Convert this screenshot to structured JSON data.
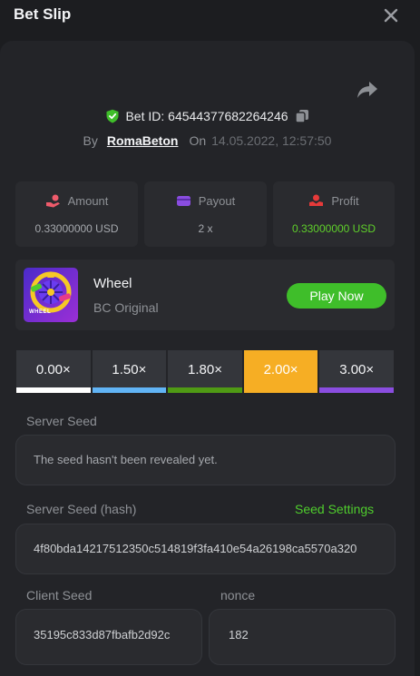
{
  "header": {
    "title": "Bet Slip",
    "close_icon": "close-icon"
  },
  "bet": {
    "bet_id": "Bet ID: 64544377682264246",
    "by_label": "By",
    "username": "RomaBeton",
    "on_label": "On",
    "date": "14.05.2022, 12:57:50"
  },
  "stats": {
    "amount_label": "Amount",
    "amount_value": "0.33000000 USD",
    "payout_label": "Payout",
    "payout_value": "2 x",
    "profit_label": "Profit",
    "profit_value": "0.33000000 USD"
  },
  "game": {
    "name": "Wheel",
    "subtitle": "BC Original",
    "play_label": "Play Now",
    "thumb_text": "WHEEL"
  },
  "multipliers": [
    {
      "label": "0.00×",
      "color": "#ffffff"
    },
    {
      "label": "1.50×",
      "color": "#61b4f5"
    },
    {
      "label": "1.80×",
      "color": "#4f9a14"
    },
    {
      "label": "2.00×",
      "color": "#f6ae24"
    },
    {
      "label": "3.00×",
      "color": "#8a4de0"
    }
  ],
  "seeds": {
    "server_seed_label": "Server Seed",
    "server_seed_value": "The seed hasn't been revealed yet.",
    "server_hash_label": "Server Seed (hash)",
    "seed_settings_label": "Seed Settings",
    "server_hash_value": "4f80bda14217512350c514819f3fa410e54a26198ca5570a320",
    "client_seed_label": "Client Seed",
    "client_seed_value": "35195c833d87fbafb2d92c",
    "nonce_label": "nonce",
    "nonce_value": "182"
  },
  "colors": {
    "accent_green": "#3fbe2a",
    "active_multiplier": "#f6ae24",
    "background": "#1c1d20",
    "panel": "#232428"
  }
}
